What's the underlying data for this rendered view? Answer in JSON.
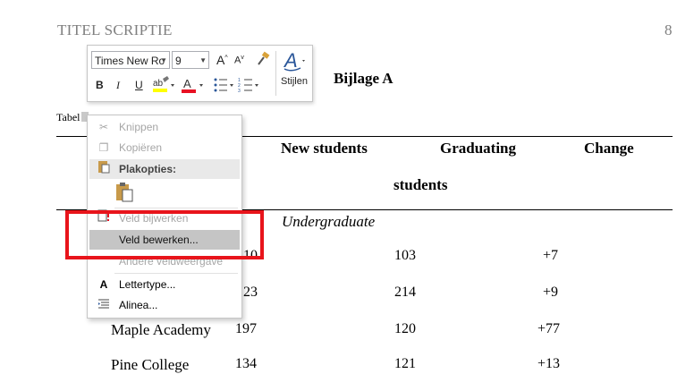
{
  "document": {
    "running_head": "TITEL SCRIPTIE",
    "page_number": "8",
    "appendix_title": "Bijlage A",
    "caption_prefix": "Tabel",
    "caption_rest": "",
    "table": {
      "headers": [
        "New students",
        "Graduating",
        "Change"
      ],
      "header_second_line": "students",
      "section": "Undergraduate",
      "rows": [
        {
          "name": "",
          "c1": "10",
          "c2": "103",
          "c3": "+7"
        },
        {
          "name": "",
          "c1": "23",
          "c2": "214",
          "c3": "+9"
        },
        {
          "name": "Maple Academy",
          "c1": "197",
          "c2": "120",
          "c3": "+77"
        },
        {
          "name": "Pine College",
          "c1": "134",
          "c2": "121",
          "c3": "+13"
        }
      ]
    }
  },
  "mini_toolbar": {
    "font_name": "Times New Ro",
    "font_size": "9",
    "grow_font": "A",
    "shrink_font": "A",
    "bold": "B",
    "italic": "I",
    "underline": "U",
    "styles_label": "Stijlen",
    "highlight_color": "#ffff00",
    "font_color": "#e81123"
  },
  "context_menu": {
    "items": [
      {
        "label": "Knippen",
        "icon": "scissors-icon",
        "enabled": false
      },
      {
        "label": "Kopiëren",
        "icon": "copy-icon",
        "enabled": false
      },
      {
        "label": "Plakopties:",
        "icon": "paste-options-icon",
        "header": true
      },
      {
        "label": "Veld bijwerken",
        "icon": "update-field-icon",
        "enabled": false
      },
      {
        "label": "Veld bewerken...",
        "icon": "",
        "enabled": true,
        "hovered": true
      },
      {
        "label": "Andere veldweergave",
        "icon": "",
        "enabled": false
      },
      {
        "label": "Lettertype...",
        "icon": "font-icon",
        "enabled": true
      },
      {
        "label": "Alinea...",
        "icon": "paragraph-icon",
        "enabled": true
      }
    ]
  },
  "colors": {
    "annotation_red": "#e8141b",
    "hover_gray": "#c5c5c5",
    "styles_blue": "#2b579a"
  }
}
